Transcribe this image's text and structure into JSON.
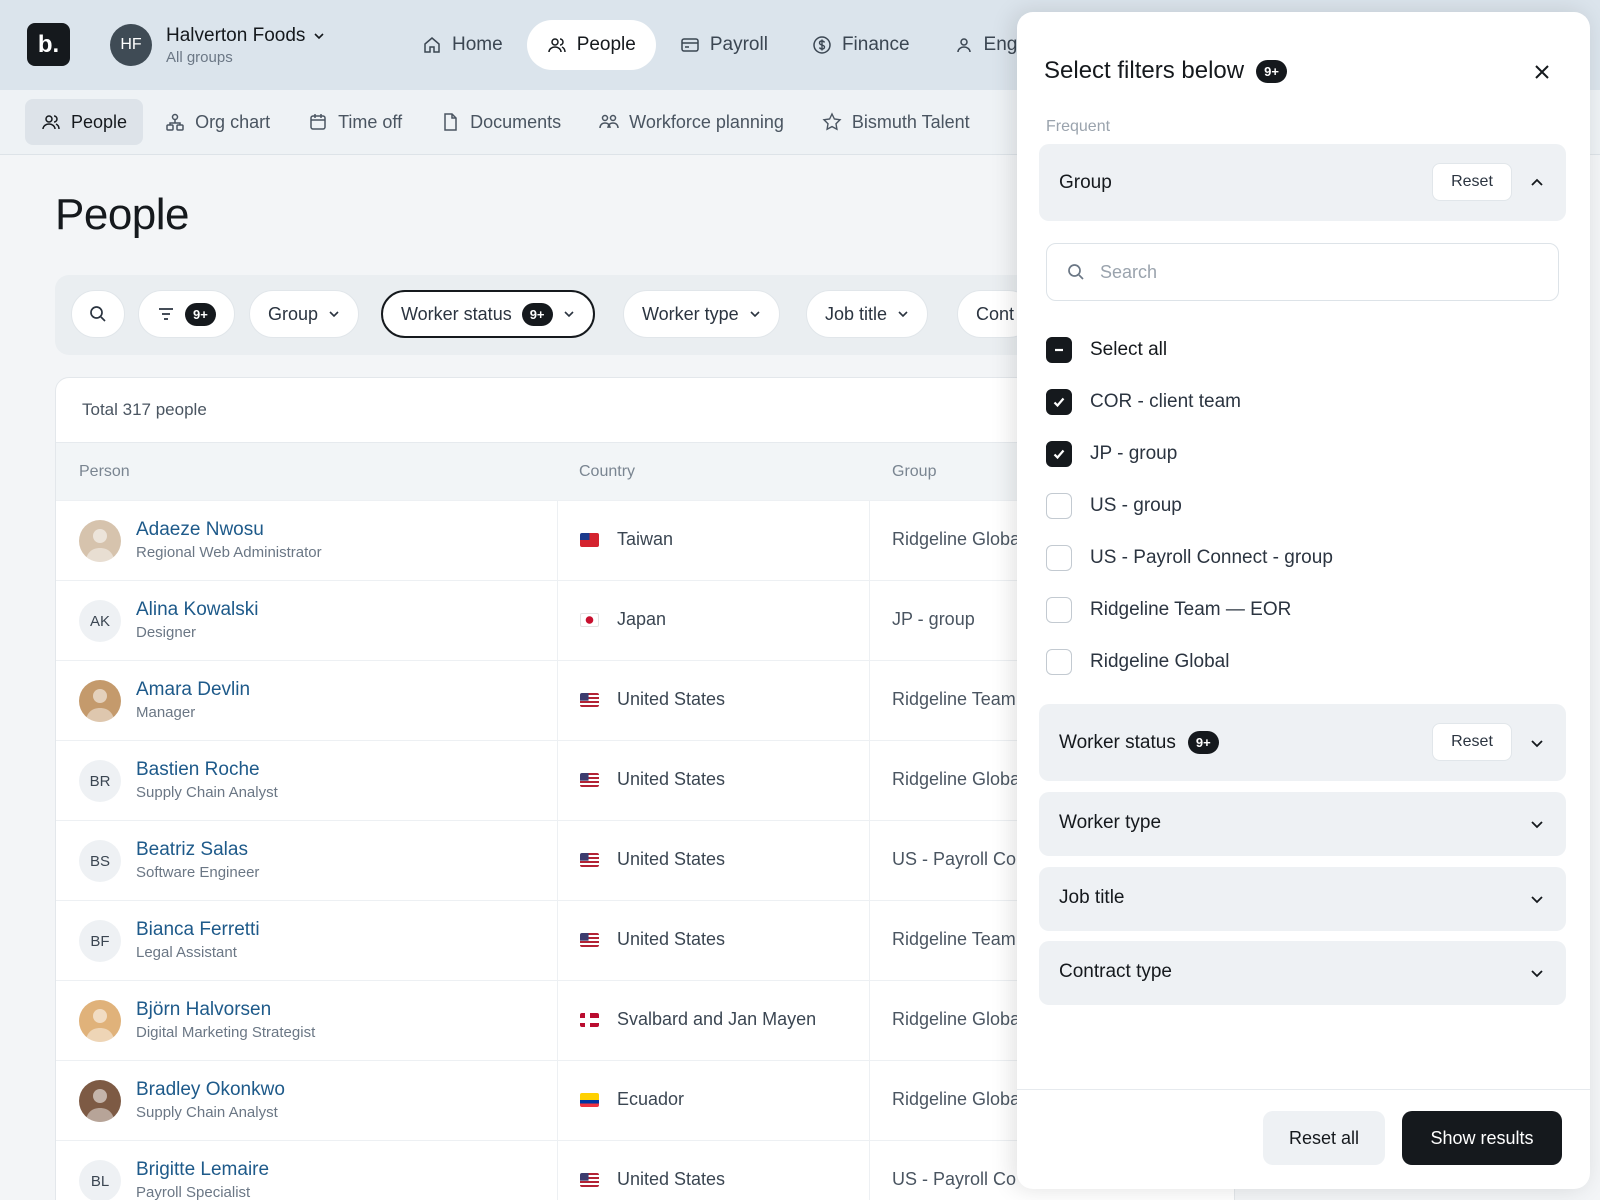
{
  "app": {
    "logo_text": "b.",
    "org_initials": "HF",
    "org_name": "Halverton Foods",
    "org_sub": "All groups"
  },
  "topnav": [
    {
      "label": "Home",
      "icon": "home-icon"
    },
    {
      "label": "People",
      "icon": "people-icon",
      "active": true
    },
    {
      "label": "Payroll",
      "icon": "payroll-icon"
    },
    {
      "label": "Finance",
      "icon": "dollar-icon"
    },
    {
      "label": "Enga",
      "icon": "person-icon"
    }
  ],
  "subnav": [
    {
      "label": "People",
      "icon": "people-icon",
      "active": true
    },
    {
      "label": "Org chart",
      "icon": "org-chart-icon"
    },
    {
      "label": "Time off",
      "icon": "calendar-icon"
    },
    {
      "label": "Documents",
      "icon": "document-icon"
    },
    {
      "label": "Workforce planning",
      "icon": "team-icon"
    },
    {
      "label": "Bismuth Talent",
      "icon": "star-icon"
    }
  ],
  "page": {
    "title": "People",
    "total": "Total 317 people"
  },
  "filters": {
    "count_badge": "9+",
    "chips": [
      "Group",
      "Worker status",
      "Worker type",
      "Job title",
      "Cont"
    ],
    "worker_status_badge": "9+"
  },
  "table": {
    "columns": [
      "Person",
      "Country",
      "Group"
    ],
    "rows": [
      {
        "name": "Adaeze Nwosu",
        "title": "Regional Web Administrator",
        "initials": "",
        "photo": true,
        "country": "Taiwan",
        "flag": "taiwan-flag-icon",
        "group": "Ridgeline Globa"
      },
      {
        "name": "Alina Kowalski",
        "title": "Designer",
        "initials": "AK",
        "photo": false,
        "country": "Japan",
        "flag": "japan-flag-icon",
        "group": "JP - group"
      },
      {
        "name": "Amara Devlin",
        "title": "Manager",
        "initials": "",
        "photo": true,
        "country": "United States",
        "flag": "us-flag-icon",
        "group": "Ridgeline Team"
      },
      {
        "name": "Bastien Roche",
        "title": "Supply Chain Analyst",
        "initials": "BR",
        "photo": false,
        "country": "United States",
        "flag": "us-flag-icon",
        "group": "Ridgeline Globa"
      },
      {
        "name": "Beatriz Salas",
        "title": "Software Engineer",
        "initials": "BS",
        "photo": false,
        "country": "United States",
        "flag": "us-flag-icon",
        "group": "US - Payroll Co"
      },
      {
        "name": "Bianca Ferretti",
        "title": "Legal Assistant",
        "initials": "BF",
        "photo": false,
        "country": "United States",
        "flag": "us-flag-icon",
        "group": "Ridgeline Team"
      },
      {
        "name": "Björn Halvorsen",
        "title": "Digital Marketing Strategist",
        "initials": "",
        "photo": true,
        "country": "Svalbard and Jan Mayen",
        "flag": "norway-flag-icon",
        "group": "Ridgeline Globa"
      },
      {
        "name": "Bradley Okonkwo",
        "title": "Supply Chain Analyst",
        "initials": "",
        "photo": true,
        "country": "Ecuador",
        "flag": "ecuador-flag-icon",
        "group": "Ridgeline Globa"
      },
      {
        "name": "Brigitte Lemaire",
        "title": "Payroll Specialist",
        "initials": "BL",
        "photo": false,
        "country": "United States",
        "flag": "us-flag-icon",
        "group": "US - Payroll Co"
      }
    ]
  },
  "drawer": {
    "title": "Select filters below",
    "title_badge": "9+",
    "frequent_label": "Frequent",
    "group_section": {
      "label": "Group",
      "reset": "Reset",
      "search_placeholder": "Search",
      "select_all": "Select all",
      "options": [
        {
          "label": "COR - client team",
          "checked": true
        },
        {
          "label": "JP - group",
          "checked": true
        },
        {
          "label": "US - group",
          "checked": false
        },
        {
          "label": "US - Payroll Connect - group",
          "checked": false
        },
        {
          "label": "Ridgeline Team — EOR",
          "checked": false
        },
        {
          "label": "Ridgeline Global",
          "checked": false
        }
      ]
    },
    "worker_status": {
      "label": "Worker status",
      "badge": "9+",
      "reset": "Reset"
    },
    "worker_type": {
      "label": "Worker type"
    },
    "job_title": {
      "label": "Job title"
    },
    "contract_type": {
      "label": "Contract type"
    },
    "reset_all": "Reset all",
    "show_results": "Show results"
  },
  "colors": {
    "accent_dark": "#15191d",
    "link": "#1e5a8a",
    "topbar_bg": "#dbe4ec"
  }
}
